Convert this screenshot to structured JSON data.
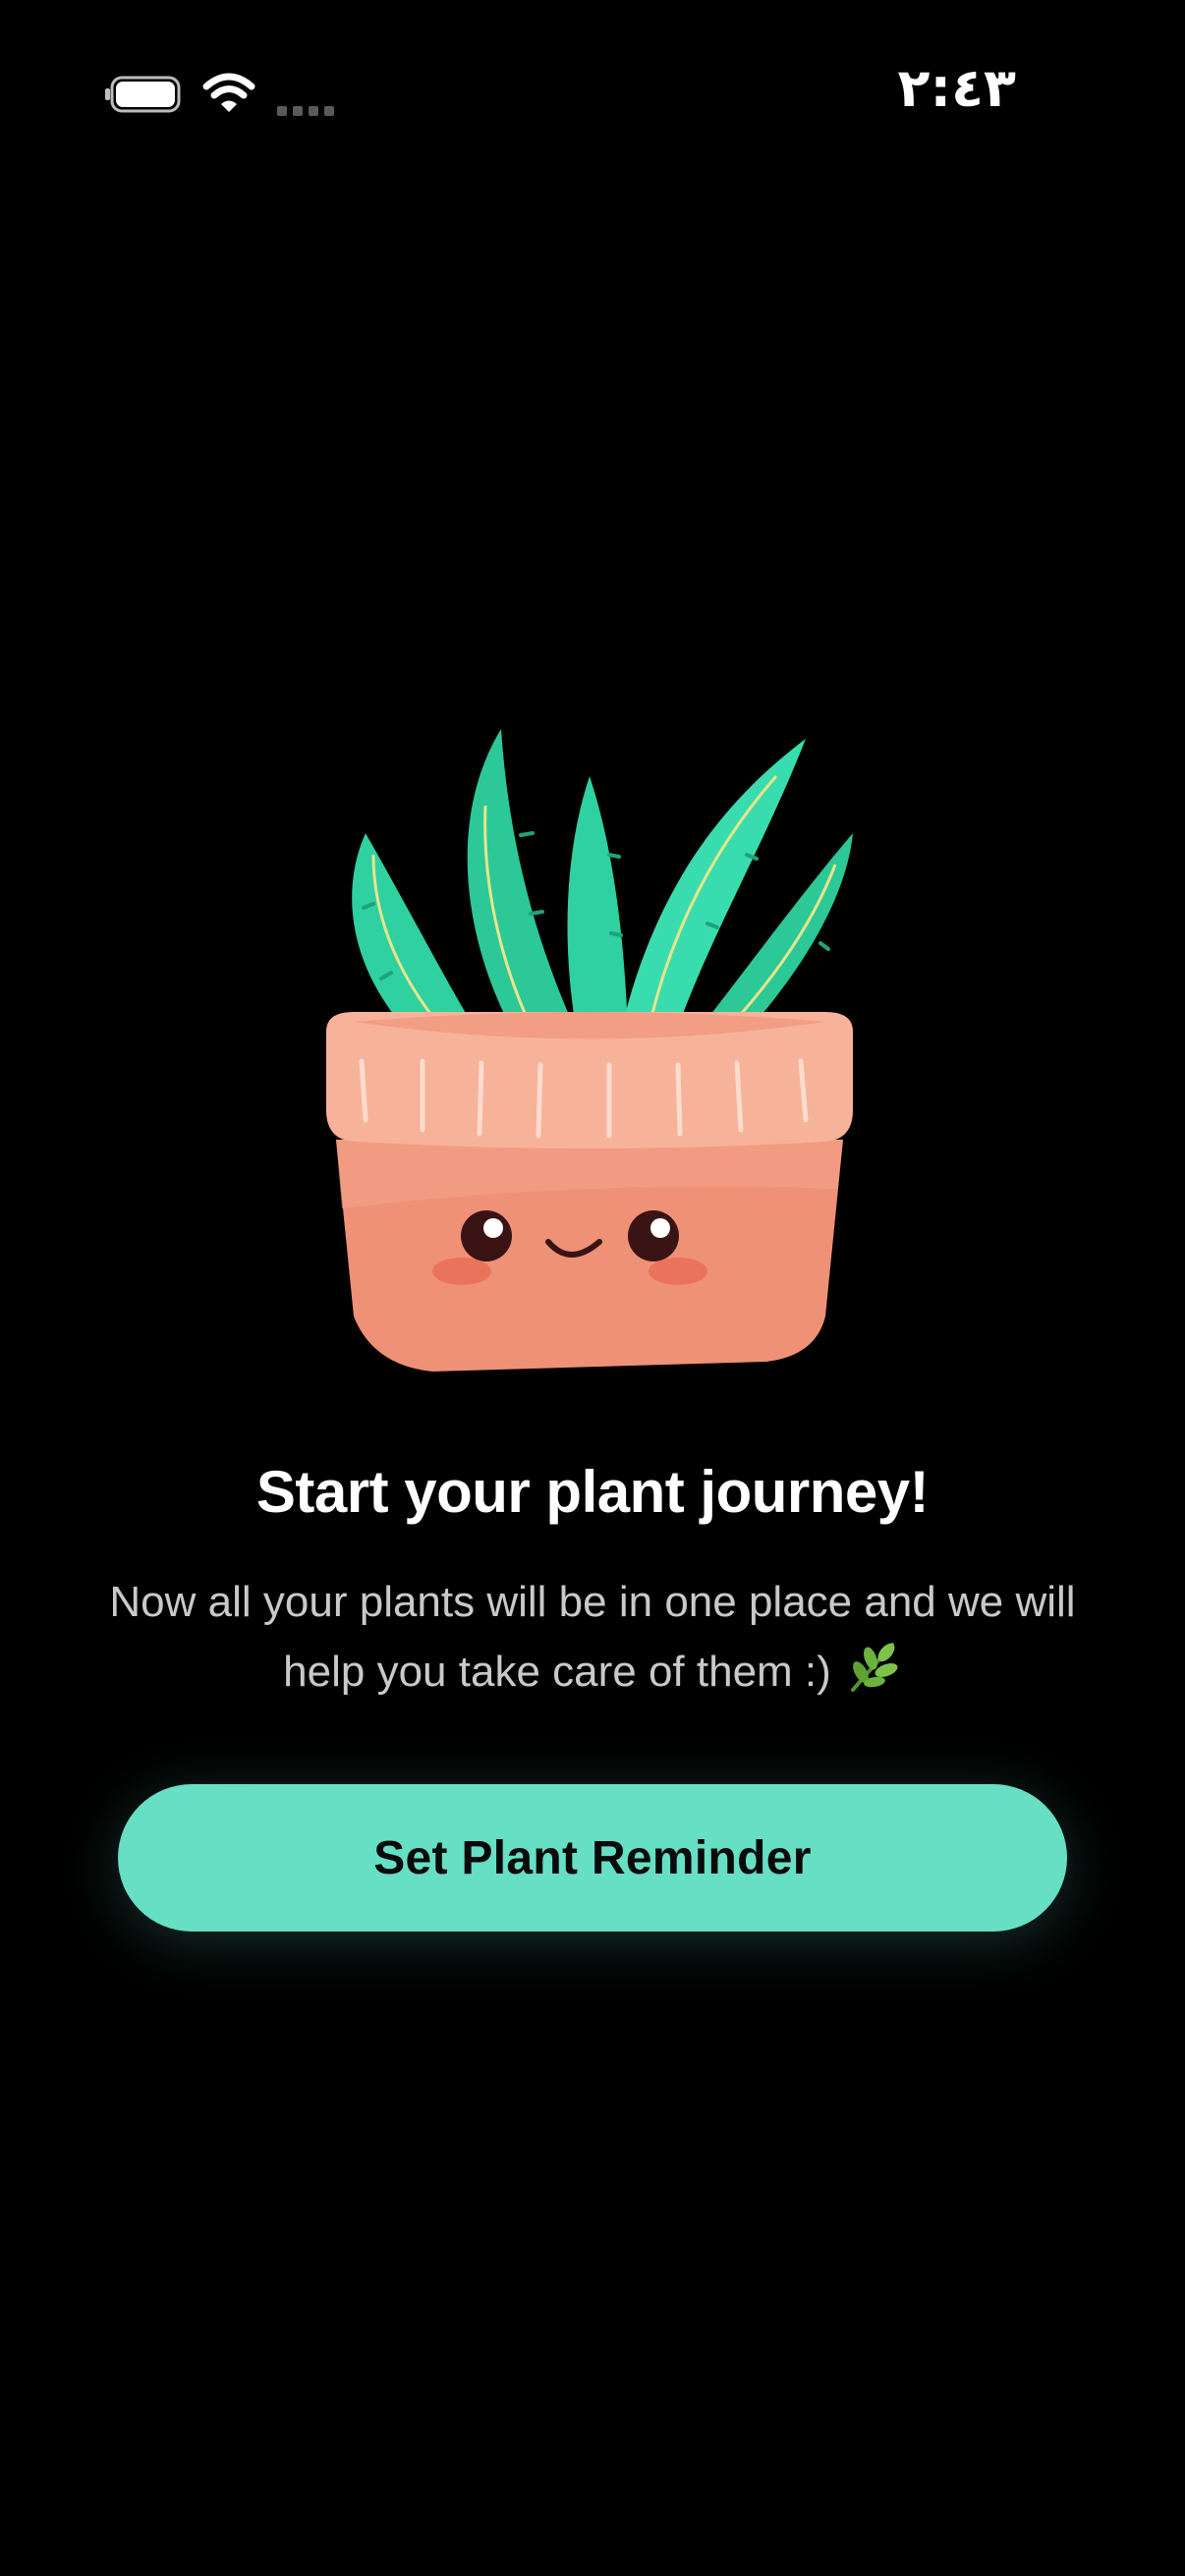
{
  "status_bar": {
    "time": "٢:٤٣",
    "icons": [
      "battery-icon",
      "wifi-icon",
      "signal-icon"
    ]
  },
  "onboarding": {
    "illustration": "smiling-potted-aloe-plant",
    "title": "Start your plant journey!",
    "description": "Now all your plants will be in one place and we will help you take care of them :)",
    "description_icon": "herb-leaf-icon",
    "primary_button_label": "Set Plant Reminder"
  },
  "colors": {
    "background": "#000000",
    "accent": "#66dfc5",
    "title_text": "#ffffff",
    "body_text": "#c9c9c9",
    "pot": "#ee9176",
    "plant": "#2fd1a1"
  }
}
